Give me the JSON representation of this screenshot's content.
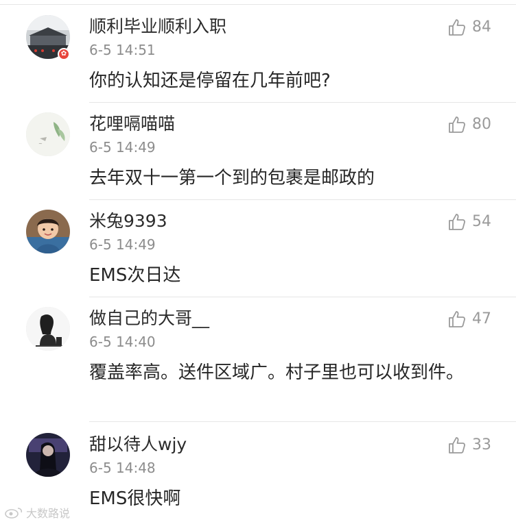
{
  "comments": [
    {
      "username": "顺利毕业顺利入职",
      "time": "6-5 14:51",
      "likes": "84",
      "text": "你的认知还是停留在几年前吧?",
      "badge": "✿"
    },
    {
      "username": "花哩嗝喵喵",
      "time": "6-5 14:49",
      "likes": "80",
      "text": "去年双十一第一个到的包裹是邮政的"
    },
    {
      "username": "米兔9393",
      "time": "6-5 14:49",
      "likes": "54",
      "text": "EMS次日达"
    },
    {
      "username": "做自己的大哥__",
      "time": "6-5 14:40",
      "likes": "47",
      "text": "覆盖率高。送件区域广。村子里也可以收到件。"
    },
    {
      "username": "甜以待人wjy",
      "time": "6-5 14:48",
      "likes": "33",
      "text": "EMS很快啊"
    }
  ],
  "watermark": {
    "text": "大数路说"
  },
  "icons": {
    "like": "thumbs-up-icon",
    "badge": "flower-badge-icon",
    "watermark": "weibo-logo-icon"
  }
}
